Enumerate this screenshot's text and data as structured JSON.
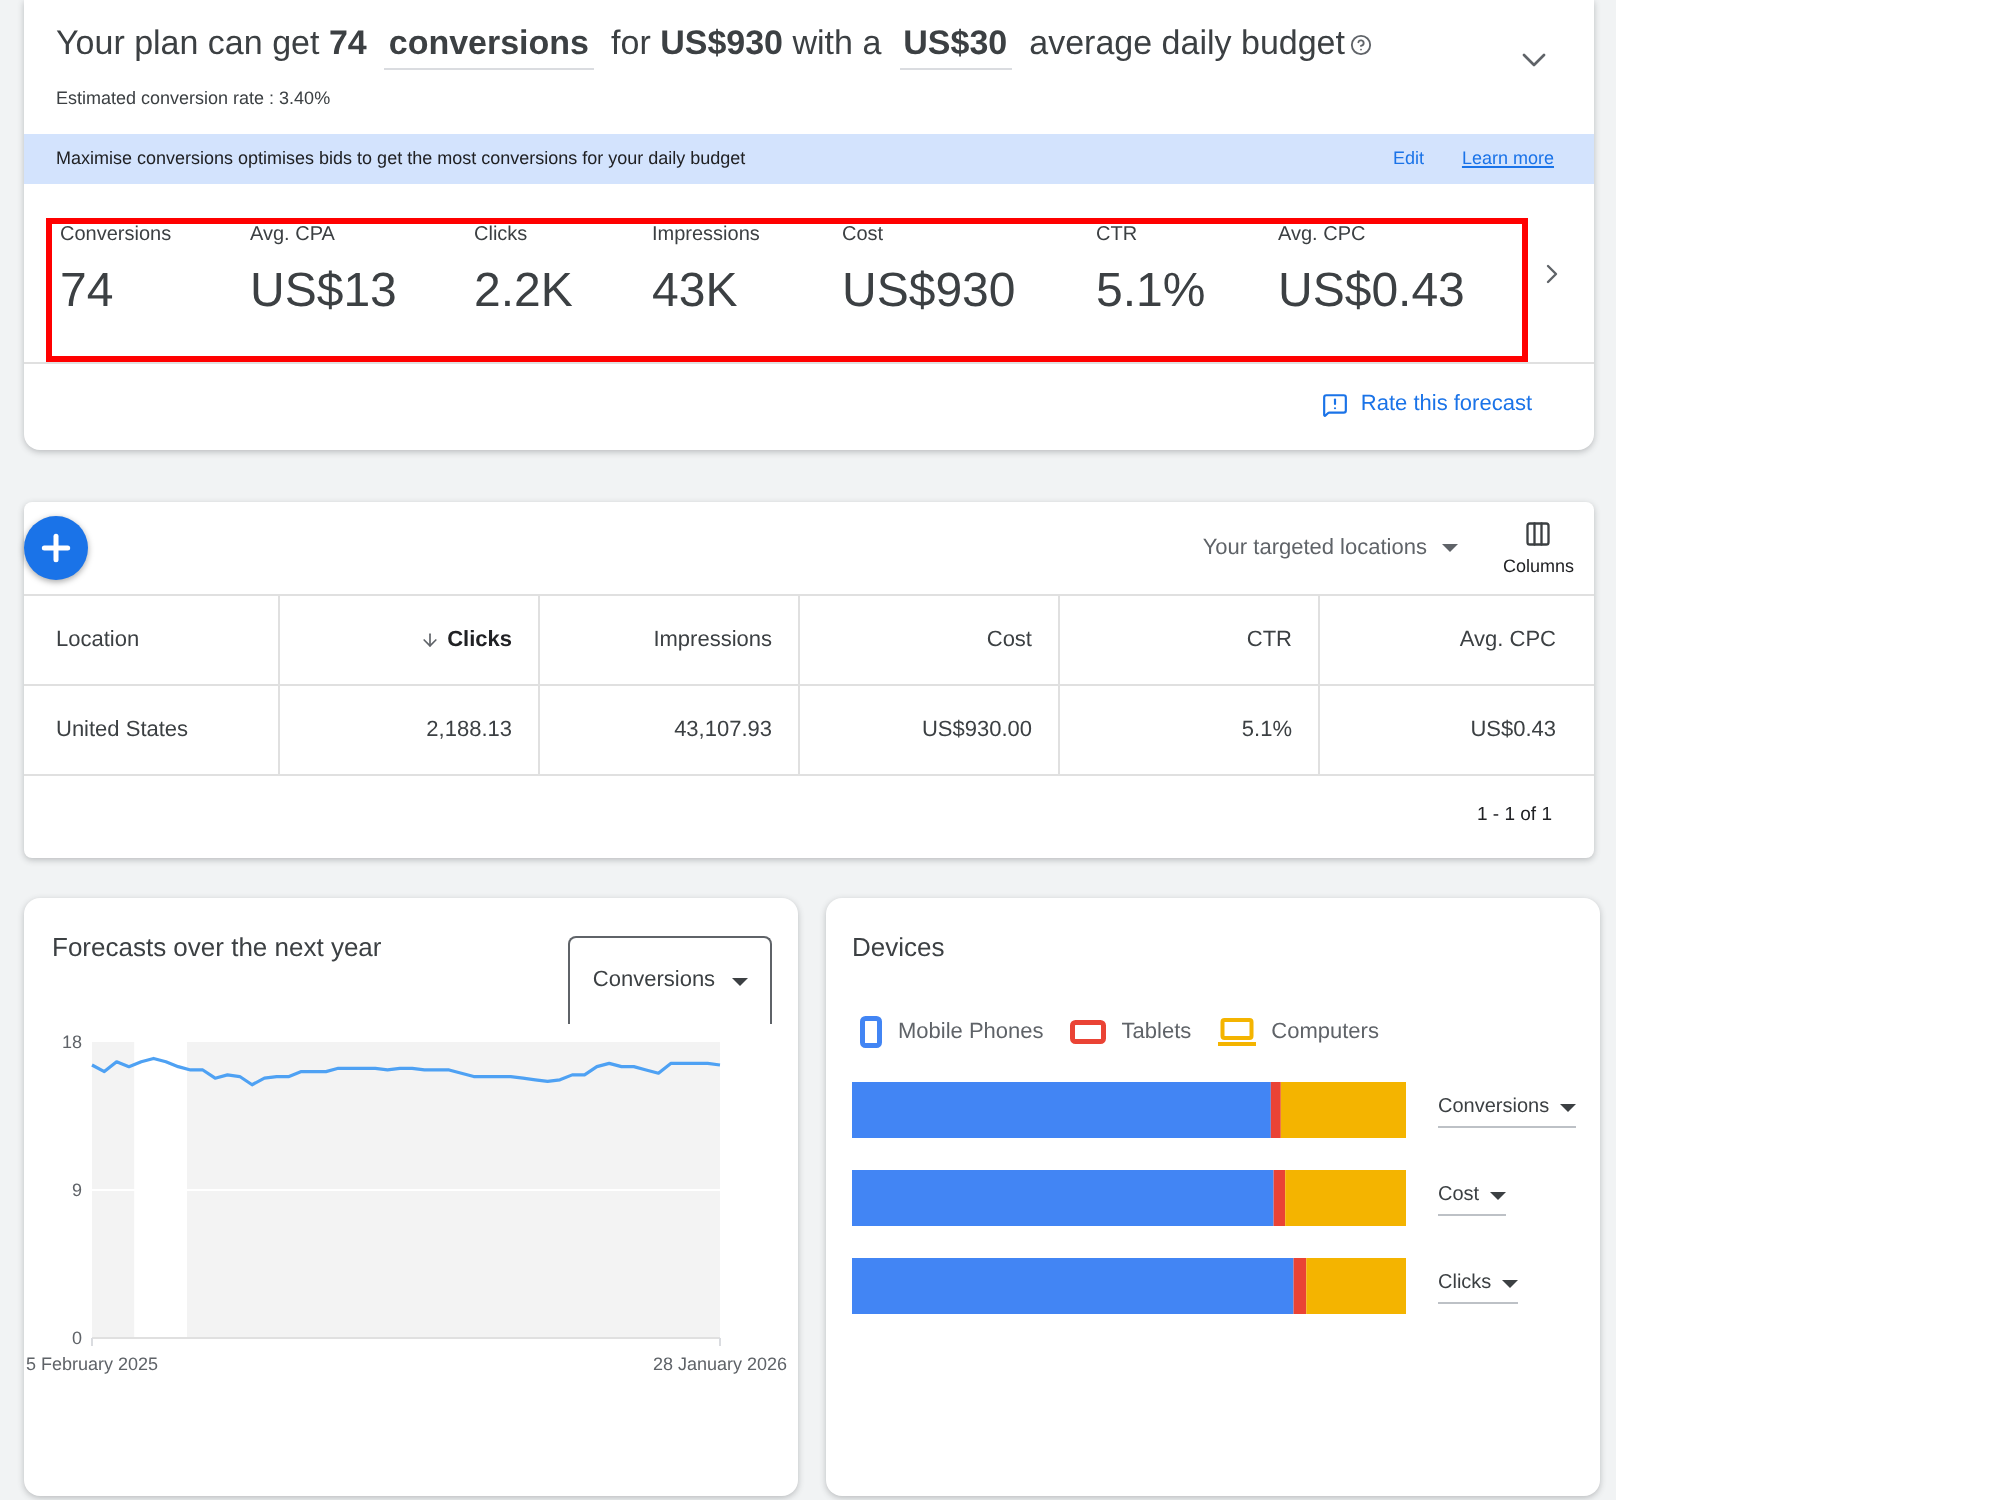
{
  "plan": {
    "headline_start": "Your plan can get **74**",
    "metric": "conversions",
    "headline_middle": "for **US$930** with a",
    "budget": "US$30",
    "headline_end": "average daily budget",
    "conversion_rate": "Estimated conversion rate : 3.40%"
  },
  "banner": {
    "text": "Maximise conversions optimises bids to get the most conversions for your daily budget",
    "actions": [
      {
        "label": "Edit",
        "kind": "button"
      },
      {
        "label": "Learn more",
        "kind": "link"
      }
    ]
  },
  "metrics": {
    "highlighted": true,
    "items": [
      {
        "label": "Conversions",
        "value": "74"
      },
      {
        "label": "Avg. CPA",
        "value": "US$13"
      },
      {
        "label": "Clicks",
        "value": "2.2K"
      },
      {
        "label": "Impressions",
        "value": "43K"
      },
      {
        "label": "Cost",
        "value": "US$930"
      },
      {
        "label": "CTR",
        "value": "5.1%"
      },
      {
        "label": "Avg. CPC",
        "value": "US$0.43"
      }
    ]
  },
  "rate_forecast": "Rate this forecast",
  "locations": {
    "filter": "Your targeted locations",
    "columns_button": "Columns",
    "columns": [
      {
        "label": "Location",
        "sorted": false
      },
      {
        "label": "Clicks",
        "sorted": true
      },
      {
        "label": "Impressions",
        "sorted": false
      },
      {
        "label": "Cost",
        "sorted": false
      },
      {
        "label": "CTR",
        "sorted": false
      },
      {
        "label": "Avg. CPC",
        "sorted": false
      }
    ],
    "rows": [
      {
        "cells": [
          "United States",
          "2,188.13",
          "43,107.93",
          "US$930.00",
          "5.1%",
          "US$0.43"
        ]
      }
    ],
    "pagination": "1 - 1 of 1"
  },
  "forecast": {
    "title": "Forecasts over the next year",
    "metric": "Conversions",
    "chart_data": {
      "type": "line",
      "x": [
        "2025-02-05",
        "2025-02-12",
        "2025-02-19",
        "2025-02-26",
        "2025-03-05",
        "2025-03-12",
        "2025-03-19",
        "2025-03-26",
        "2025-04-02",
        "2025-04-09",
        "2025-04-16",
        "2025-04-23",
        "2025-04-30",
        "2025-05-07",
        "2025-05-14",
        "2025-05-21",
        "2025-05-28",
        "2025-06-04",
        "2025-06-11",
        "2025-06-18",
        "2025-06-25",
        "2025-07-02",
        "2025-07-09",
        "2025-07-16",
        "2025-07-23",
        "2025-07-30",
        "2025-08-06",
        "2025-08-13",
        "2025-08-20",
        "2025-08-27",
        "2025-09-03",
        "2025-09-10",
        "2025-09-17",
        "2025-09-24",
        "2025-10-01",
        "2025-10-08",
        "2025-10-15",
        "2025-10-22",
        "2025-10-29",
        "2025-11-05",
        "2025-11-12",
        "2025-11-19",
        "2025-11-26",
        "2025-12-03",
        "2025-12-10",
        "2025-12-17",
        "2025-12-24",
        "2025-12-31",
        "2026-01-07",
        "2026-01-14",
        "2026-01-21",
        "2026-01-28"
      ],
      "values": [
        16.6,
        16.2,
        16.8,
        16.5,
        16.8,
        17.0,
        16.8,
        16.5,
        16.3,
        16.3,
        15.8,
        16.0,
        15.9,
        15.4,
        15.8,
        15.9,
        15.9,
        16.2,
        16.2,
        16.2,
        16.4,
        16.4,
        16.4,
        16.4,
        16.3,
        16.4,
        16.4,
        16.3,
        16.3,
        16.3,
        16.1,
        15.9,
        15.9,
        15.9,
        15.9,
        15.8,
        15.7,
        15.6,
        15.7,
        16.0,
        16.0,
        16.5,
        16.7,
        16.5,
        16.5,
        16.3,
        16.1,
        16.7,
        16.7,
        16.7,
        16.7,
        16.6
      ],
      "color": "#4ea1f3",
      "xlim": [
        "2025-02-05",
        "2026-01-28"
      ],
      "ylim": [
        0,
        18
      ],
      "yticks": [
        0,
        9,
        18
      ],
      "xticks": [
        {
          "value": "2025-02-05",
          "label": "5 February 2025"
        },
        {
          "value": "2026-01-28",
          "label": "28 January 2026"
        }
      ],
      "grid": true,
      "bands": [
        {
          "axis": "x",
          "from": "2025-03-01",
          "to": "2025-03-31",
          "color": "#ffffff"
        }
      ]
    }
  },
  "devices": {
    "title": "Devices",
    "legend": [
      {
        "label": "Mobile Phones",
        "color": "#4285f4",
        "kind": "phone"
      },
      {
        "label": "Tablets",
        "color": "#ea4335",
        "kind": "tablet"
      },
      {
        "label": "Computers",
        "color": "#f4b400",
        "kind": "computer"
      }
    ],
    "rows": [
      {
        "metric": "Conversions"
      },
      {
        "metric": "Cost"
      },
      {
        "metric": "Clicks"
      }
    ]
  }
}
